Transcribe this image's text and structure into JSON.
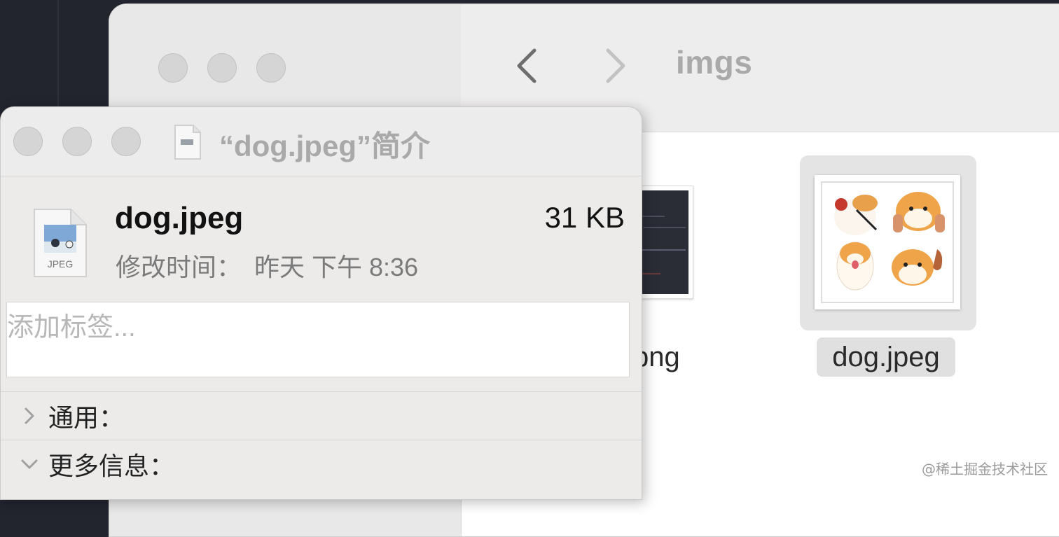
{
  "finder": {
    "title": "imgs",
    "back_icon": "chevron-left-icon",
    "forward_icon": "chevron-right-icon",
    "files": [
      {
        "name": "png",
        "selected": false
      },
      {
        "name": "dog.jpeg",
        "selected": true
      }
    ]
  },
  "info_window": {
    "title": "“dog.jpeg”简介",
    "file_name": "dog.jpeg",
    "file_size": "31 KB",
    "modified_label": "修改时间：",
    "modified_value": "昨天 下午 8:36",
    "file_icon_label": "JPEG",
    "tag_placeholder": "添加标签...",
    "sections": [
      {
        "label": "通用：",
        "expanded": false
      },
      {
        "label": "更多信息：",
        "expanded": true
      }
    ]
  },
  "watermark": "@稀土掘金技术社区",
  "colors": {
    "desktop": "#22242e",
    "panel_bg": "#ecebea",
    "traffic_light_inactive": "#d6d5d5",
    "selection_bg": "#e0e0e0"
  }
}
